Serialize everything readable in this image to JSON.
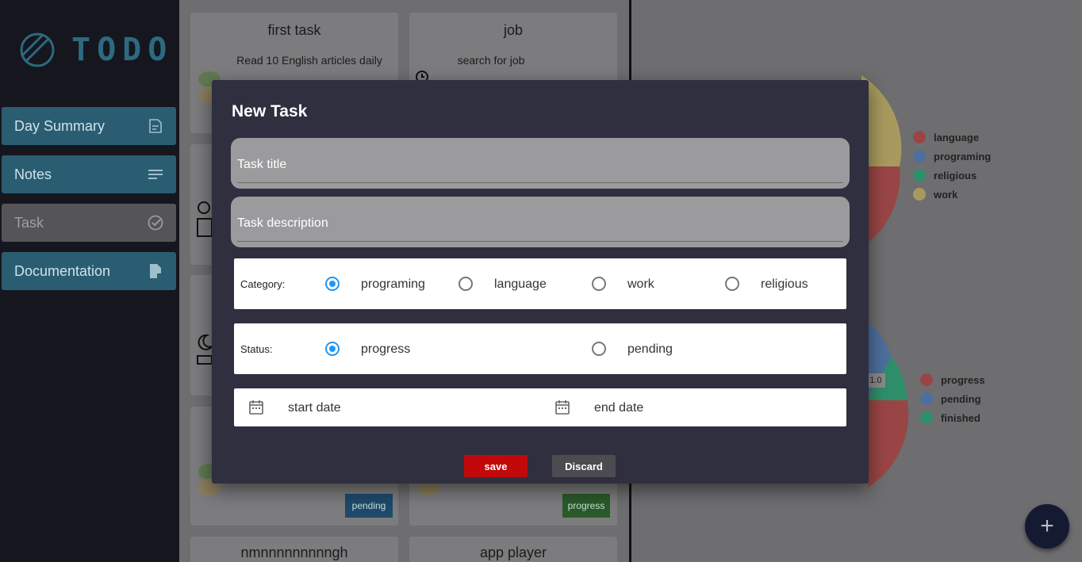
{
  "app": {
    "logo_text": "TODO"
  },
  "sidebar": {
    "items": [
      {
        "label": "Day Summary",
        "icon": "summary-icon"
      },
      {
        "label": "Notes",
        "icon": "notes-icon"
      },
      {
        "label": "Task",
        "icon": "check-circle-icon"
      },
      {
        "label": "Documentation",
        "icon": "document-icon"
      }
    ]
  },
  "background_cards": [
    {
      "title": "first task",
      "description": "Read 10 English articles daily"
    },
    {
      "title": "job",
      "description": "search for job"
    },
    {
      "status": "pending"
    },
    {
      "status": "progress"
    },
    {
      "title": "nmnnnnnnnnngh"
    },
    {
      "title": "app player"
    }
  ],
  "category_chart_legend": [
    "language",
    "programing",
    "religious",
    "work"
  ],
  "status_chart_legend": [
    "progress",
    "pending",
    "finished"
  ],
  "status_chart_value_label": "1.0",
  "colors": {
    "language": "#c04f4f",
    "programing": "#4d6f9e",
    "religious": "#2f8f6a",
    "work": "#a89a5e",
    "accent": "#2196f3",
    "save": "#c1090b"
  },
  "dialog": {
    "title": "New Task",
    "task_title_placeholder": "Task title",
    "task_description_placeholder": "Task description",
    "category": {
      "label": "Category:",
      "options": [
        "programing",
        "language",
        "work",
        "religious"
      ],
      "selected": "programing"
    },
    "status": {
      "label": "Status:",
      "options": [
        "progress",
        "pending"
      ],
      "selected": "progress"
    },
    "start_date_placeholder": "start date",
    "end_date_placeholder": "end date",
    "save_label": "save",
    "discard_label": "Discard"
  },
  "fab_label": "+"
}
